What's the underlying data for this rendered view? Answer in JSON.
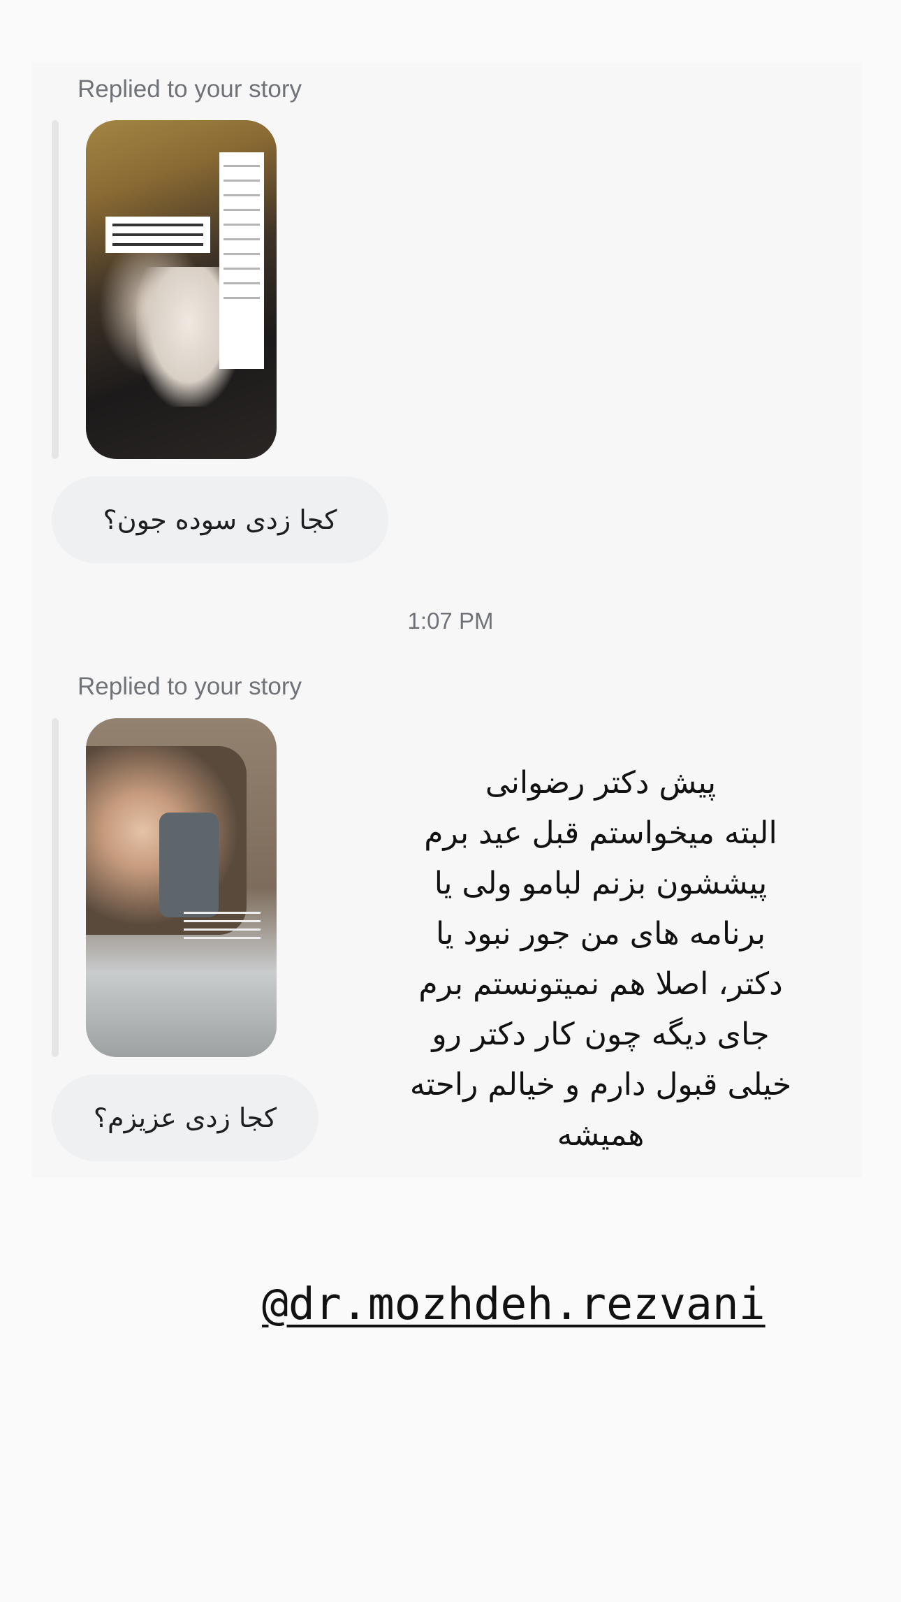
{
  "messages": [
    {
      "reply_label": "Replied to your story",
      "story_icon": "story-thumbnail-image",
      "text": "کجا زدی سوده جون؟"
    },
    {
      "reply_label": "Replied to your story",
      "story_icon": "story-thumbnail-image",
      "text": "کجا زدی عزیزم؟"
    }
  ],
  "timestamp": "1:07 PM",
  "story_overlay": {
    "lines": [
      "پیش دکتر رضوانی",
      "البته میخواستم قبل عید برم",
      "پیششون بزنم لبامو ولی یا",
      "برنامه های من جور نبود یا",
      "دکتر، اصلا هم نمیتونستم برم",
      "جای دیگه چون کار دکتر رو",
      "خیلی قبول دارم و خیالم راحته",
      "همیشه"
    ],
    "handle": "@dr.mozhdeh.rezvani"
  },
  "colors": {
    "background": "#fafafa",
    "card": "#f7f7f8",
    "bubble": "#eff0f2",
    "muted_text": "#6f7378",
    "text": "#1c1e21"
  }
}
